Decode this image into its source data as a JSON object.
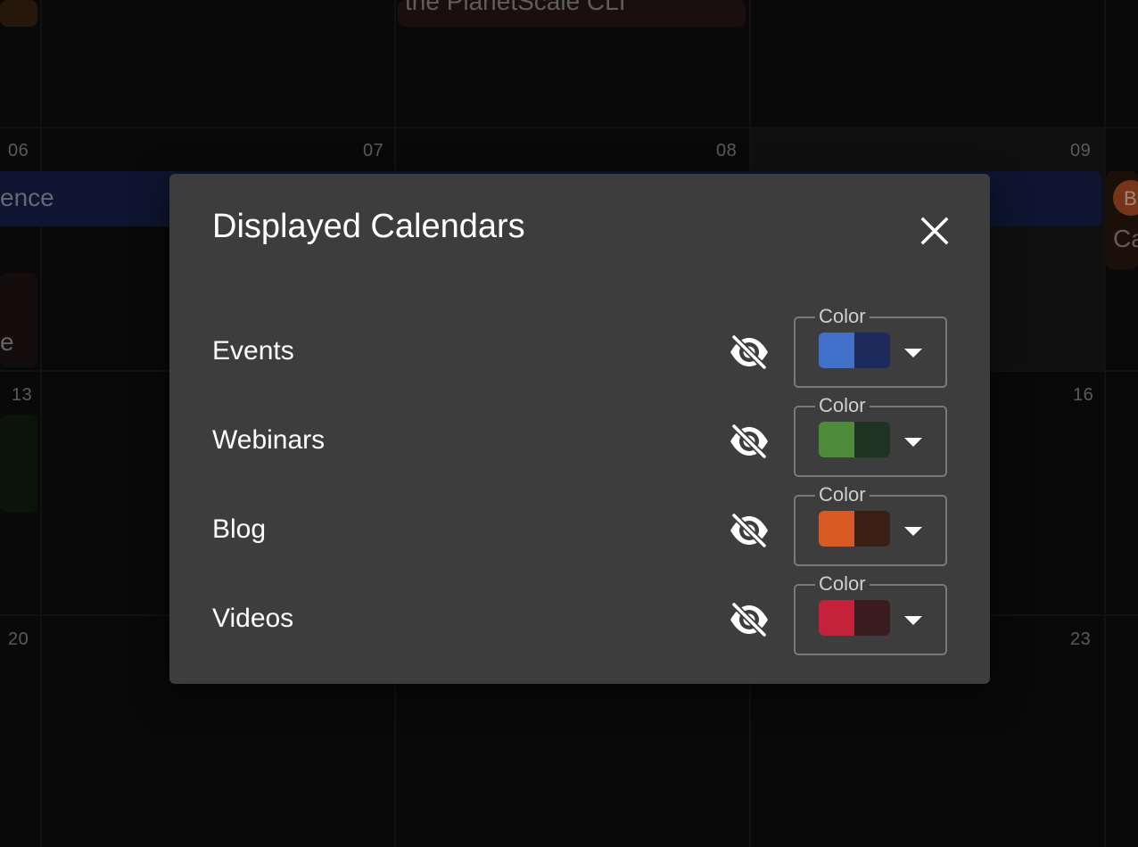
{
  "calendar": {
    "day_numbers": [
      "06",
      "07",
      "08",
      "09",
      "13",
      "16",
      "20",
      "23"
    ],
    "events": {
      "top_event": "the PlanetScale CLI",
      "conference": "ence",
      "left_e": "e",
      "right_badge": "B",
      "right_text": "Ca"
    }
  },
  "dialog": {
    "title": "Displayed Calendars",
    "close_icon": "close-icon",
    "color_label": "Color",
    "calendars": [
      {
        "name": "Events",
        "primary": "#4070c8",
        "secondary": "#1d2a5c"
      },
      {
        "name": "Webinars",
        "primary": "#4d8a3a",
        "secondary": "#1f3320"
      },
      {
        "name": "Blog",
        "primary": "#d95a22",
        "secondary": "#3a1f12"
      },
      {
        "name": "Videos",
        "primary": "#c4223a",
        "secondary": "#3a1c20"
      }
    ],
    "visibility_icon": "visibility-off-icon",
    "dropdown_icon": "arrow-drop-down-icon"
  }
}
